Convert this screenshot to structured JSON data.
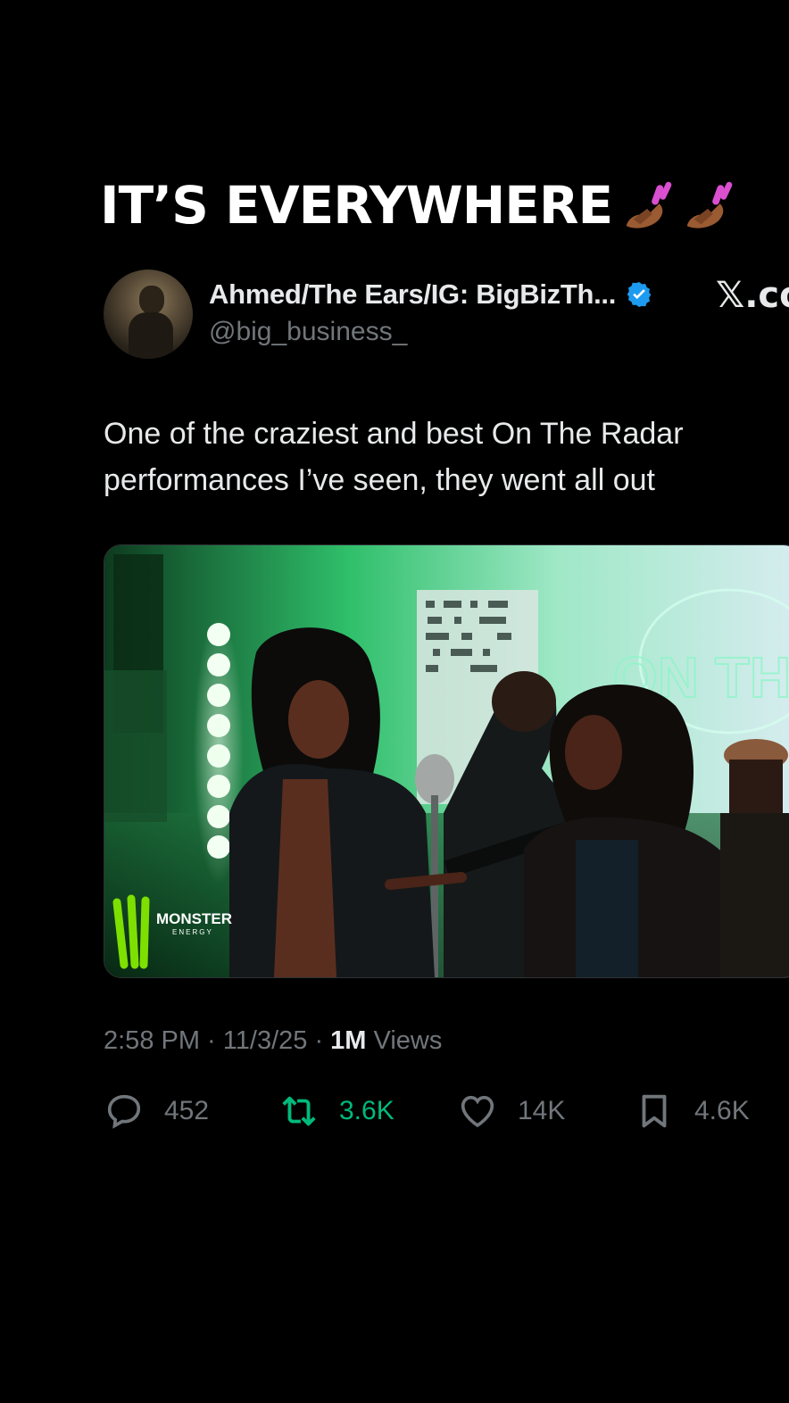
{
  "caption": {
    "text": "IT’S EVERYWHERE",
    "emoji": "nail-polish-icon x2"
  },
  "tweet": {
    "author_name": "Ahmed/The Ears/IG: BigBizTh...",
    "handle": "@big_business_",
    "platform_logo": "𝕏.co",
    "body_line1": "One of the craziest and best On The Radar",
    "body_line2": "performances I’ve seen, they went all out",
    "media": {
      "logo_left": "MONSTER",
      "logo_left_sub": "ENERGY",
      "sign_text": "ON THE RADAR"
    },
    "time": "2:58 PM",
    "date": "11/3/25",
    "views_count": "1M",
    "views_label": " Views",
    "sep": " · ",
    "replies": "452",
    "retweets": "3.6K",
    "likes": "14K",
    "bookmarks": "4.6K"
  },
  "colors": {
    "background": "#000000",
    "text": "#e7e9ea",
    "muted": "#71767b",
    "retweet": "#00ba7c",
    "verified": "#1d9bf0"
  }
}
